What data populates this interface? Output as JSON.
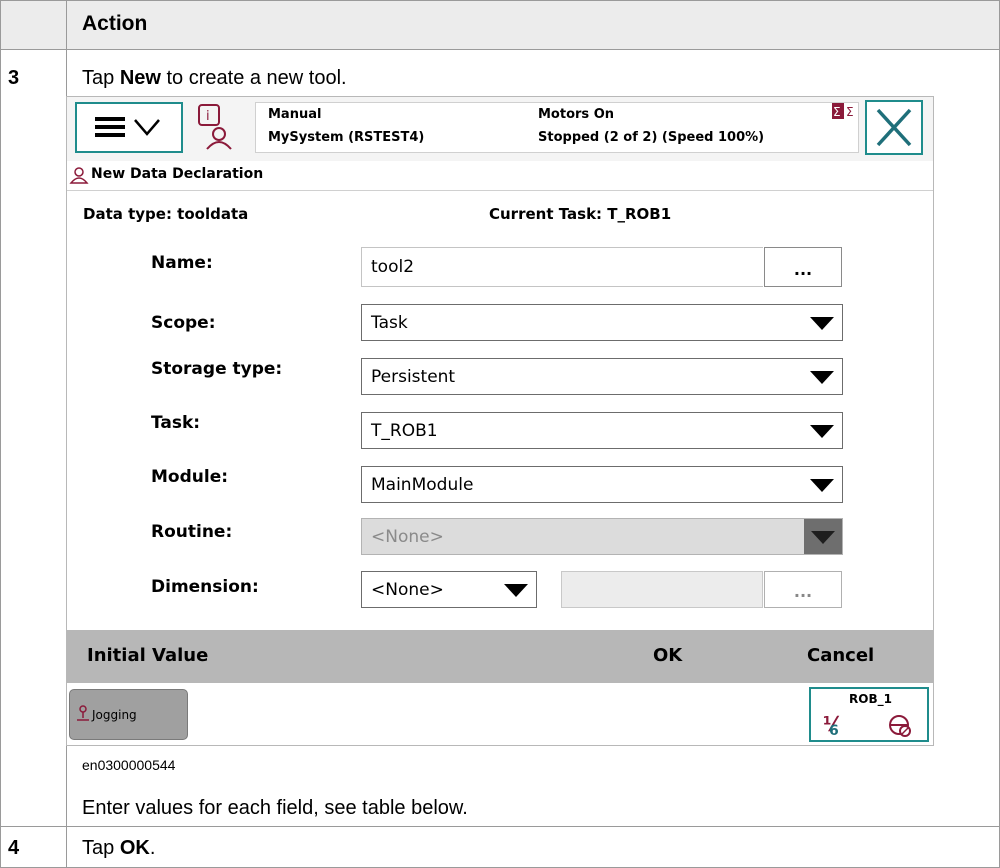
{
  "doc": {
    "header": "Action",
    "step3_num": "3",
    "step3_pre": "Tap ",
    "step3_bold": "New",
    "step3_post": " to create a new tool.",
    "figure_id": "en0300000544",
    "instruction": "Enter values for each field, see table below.",
    "step4_num": "4",
    "step4_pre": "Tap ",
    "step4_bold": "OK",
    "step4_post": "."
  },
  "status": {
    "mode": "Manual",
    "system": "MySystem (RSTEST4)",
    "motors": "Motors On",
    "state": "Stopped (2 of 2) (Speed 100%)"
  },
  "window": {
    "title": "New Data Declaration",
    "data_type": "Data type: tooldata",
    "current_task": "Current Task:  T_ROB1"
  },
  "form": {
    "name_label": "Name:",
    "name_value": "tool2",
    "dots": "...",
    "scope_label": "Scope:",
    "scope_value": "Task",
    "storage_label": "Storage type:",
    "storage_value": "Persistent",
    "task_label": "Task:",
    "task_value": "T_ROB1",
    "module_label": "Module:",
    "module_value": "MainModule",
    "routine_label": "Routine:",
    "routine_value": "<None>",
    "dimension_label": "Dimension:",
    "dimension_value": "<None>"
  },
  "bottom": {
    "initial_value": "Initial Value",
    "ok": "OK",
    "cancel": "Cancel"
  },
  "footer": {
    "jogging": "Jogging",
    "rob": "ROB_1",
    "fraction": "1/3"
  },
  "colors": {
    "accent": "#1f8c8c",
    "info_icon": "#8b1a3a",
    "bottom_bar": "#b7b7b7"
  }
}
